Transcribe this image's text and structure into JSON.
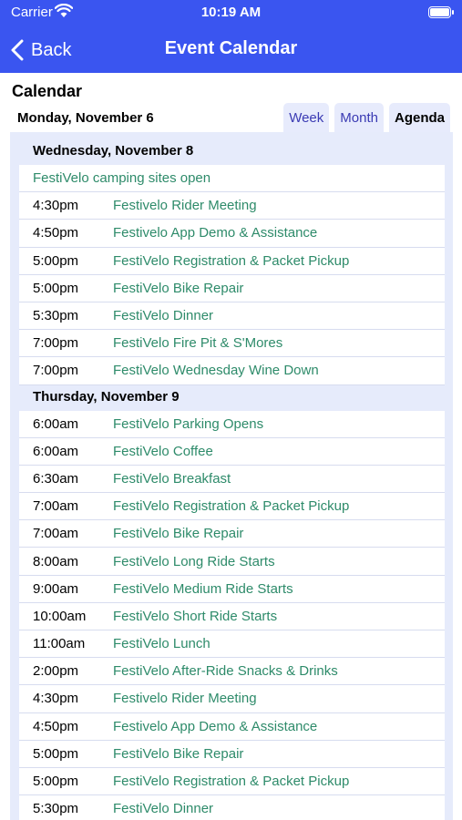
{
  "status": {
    "carrier": "Carrier",
    "time": "10:19 AM"
  },
  "nav": {
    "back_label": "Back",
    "title": "Event Calendar"
  },
  "heading": "Calendar",
  "current_date": "Monday, November 6",
  "tabs": [
    "Week",
    "Month",
    "Agenda"
  ],
  "active_tab": "Agenda",
  "days": [
    {
      "header": "Wednesday, November 8",
      "all_day": "FestiVelo camping sites open",
      "events": [
        {
          "time": "4:30pm",
          "title": "Festivelo Rider Meeting"
        },
        {
          "time": "4:50pm",
          "title": "Festivelo App Demo & Assistance"
        },
        {
          "time": "5:00pm",
          "title": "FestiVelo Registration & Packet Pickup"
        },
        {
          "time": "5:00pm",
          "title": "FestiVelo Bike Repair"
        },
        {
          "time": "5:30pm",
          "title": "FestiVelo Dinner"
        },
        {
          "time": "7:00pm",
          "title": "FestiVelo Fire Pit & S'Mores"
        },
        {
          "time": "7:00pm",
          "title": "FestiVelo Wednesday Wine Down"
        }
      ]
    },
    {
      "header": "Thursday, November 9",
      "events": [
        {
          "time": "6:00am",
          "title": "FestiVelo Parking Opens"
        },
        {
          "time": "6:00am",
          "title": "FestiVelo Coffee"
        },
        {
          "time": "6:30am",
          "title": "FestiVelo Breakfast"
        },
        {
          "time": "7:00am",
          "title": "FestiVelo Registration & Packet Pickup"
        },
        {
          "time": "7:00am",
          "title": "FestiVelo Bike Repair"
        },
        {
          "time": "8:00am",
          "title": "FestiVelo Long Ride Starts"
        },
        {
          "time": "9:00am",
          "title": "FestiVelo Medium Ride Starts"
        },
        {
          "time": "10:00am",
          "title": "FestiVelo Short Ride Starts"
        },
        {
          "time": "11:00am",
          "title": "FestiVelo Lunch"
        },
        {
          "time": "2:00pm",
          "title": "FestiVelo After-Ride Snacks & Drinks"
        },
        {
          "time": "4:30pm",
          "title": "Festivelo Rider Meeting"
        },
        {
          "time": "4:50pm",
          "title": "Festivelo App Demo & Assistance"
        },
        {
          "time": "5:00pm",
          "title": "FestiVelo Bike Repair"
        },
        {
          "time": "5:00pm",
          "title": "FestiVelo Registration & Packet Pickup"
        },
        {
          "time": "5:30pm",
          "title": "FestiVelo Dinner"
        }
      ]
    }
  ],
  "colors": {
    "nav": "#3a55f0",
    "event_title": "#2e8b6a",
    "agenda_bg": "#e6ebfb",
    "tab_text": "#3a3ab3"
  }
}
